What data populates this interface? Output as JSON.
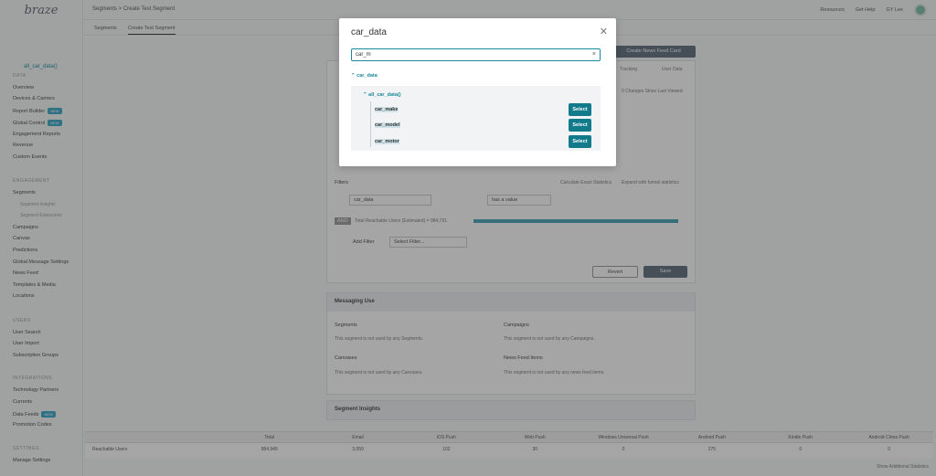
{
  "sidebar": {
    "logo": "braze",
    "app": "all_car_data()",
    "data_section": "DATA",
    "data_items": [
      "Overview",
      "Devices & Carriers",
      "Report Builder",
      "Global Control",
      "Engagement Reports",
      "Revenue",
      "Custom Events"
    ],
    "badge_new": "NEW",
    "engagement_section": "ENGAGEMENT",
    "segments": "Segments",
    "segments_sub": [
      "Segment Insights",
      "Segment Extensions"
    ],
    "engagement_items": [
      "Campaigns",
      "Canvas",
      "Predictions",
      "Global Message Settings",
      "News Feed",
      "Templates & Media",
      "Locations"
    ],
    "users_section": "USERS",
    "users_items": [
      "User Search",
      "User Import",
      "Subscription Groups"
    ],
    "integrations_section": "INTEGRATIONS",
    "integrations_items": [
      "Technology Partners",
      "Currents",
      "Data Feeds",
      "Promotion Codes"
    ],
    "settings_section": "SETTINGS",
    "settings_items": [
      "Manage Settings"
    ]
  },
  "topbar": {
    "breadcrumb": "Segments > Create Test Segment",
    "resources": "Resources",
    "get_help": "Get Help",
    "user": "GY Lee"
  },
  "tabs": [
    "Segments",
    "Create Test Segment"
  ],
  "background": {
    "create_news_feed": "Create News Feed Card",
    "tracking": "Tracking",
    "user_data": "User Data",
    "changes": "0 Changes Since Last Viewed",
    "filters_label": "Filters",
    "calc_exact": "Calculate Exact Statistics",
    "expand_funnel": "Expand with funnel statistics",
    "filter_field": "car_data",
    "filter_op": "has a value",
    "and_label": "AND",
    "reachable": "Total Reachable Users (Estimated) = 984,791",
    "add_filter": "Add Filter",
    "select_filter": "Select Filter...",
    "revert": "Revert",
    "save": "Save",
    "messaging_use": "Messaging Use",
    "segments_h": "Segments",
    "segments_txt": "This segment is not used by any Segments.",
    "campaigns_h": "Campaigns",
    "campaigns_txt": "This segment is not used by any Campaigns.",
    "canvases_h": "Canvases",
    "canvases_txt": "This segment is not used by any Canvases.",
    "newsfeed_h": "News Feed Items",
    "newsfeed_txt": "This segment is not used by any news feed items.",
    "segment_insights": "Segment Insights",
    "show_additional": "Show Additional Statistics"
  },
  "table": {
    "headers": [
      "",
      "Total",
      "Email",
      "iOS Push",
      "Web Push",
      "Windows Universal Push",
      "Android Push",
      "Kindle Push",
      "Android China Push"
    ],
    "row": [
      "Reachable Users",
      "984,949",
      "3,959",
      "102",
      "30",
      "0",
      "275",
      "0",
      "0"
    ]
  },
  "modal": {
    "title": "car_data",
    "search_value": "car_m",
    "root": "car_data",
    "sub": "all_car_data()",
    "leaves": [
      "car_make",
      "car_model",
      "car_motor"
    ],
    "select_label": "Select"
  }
}
